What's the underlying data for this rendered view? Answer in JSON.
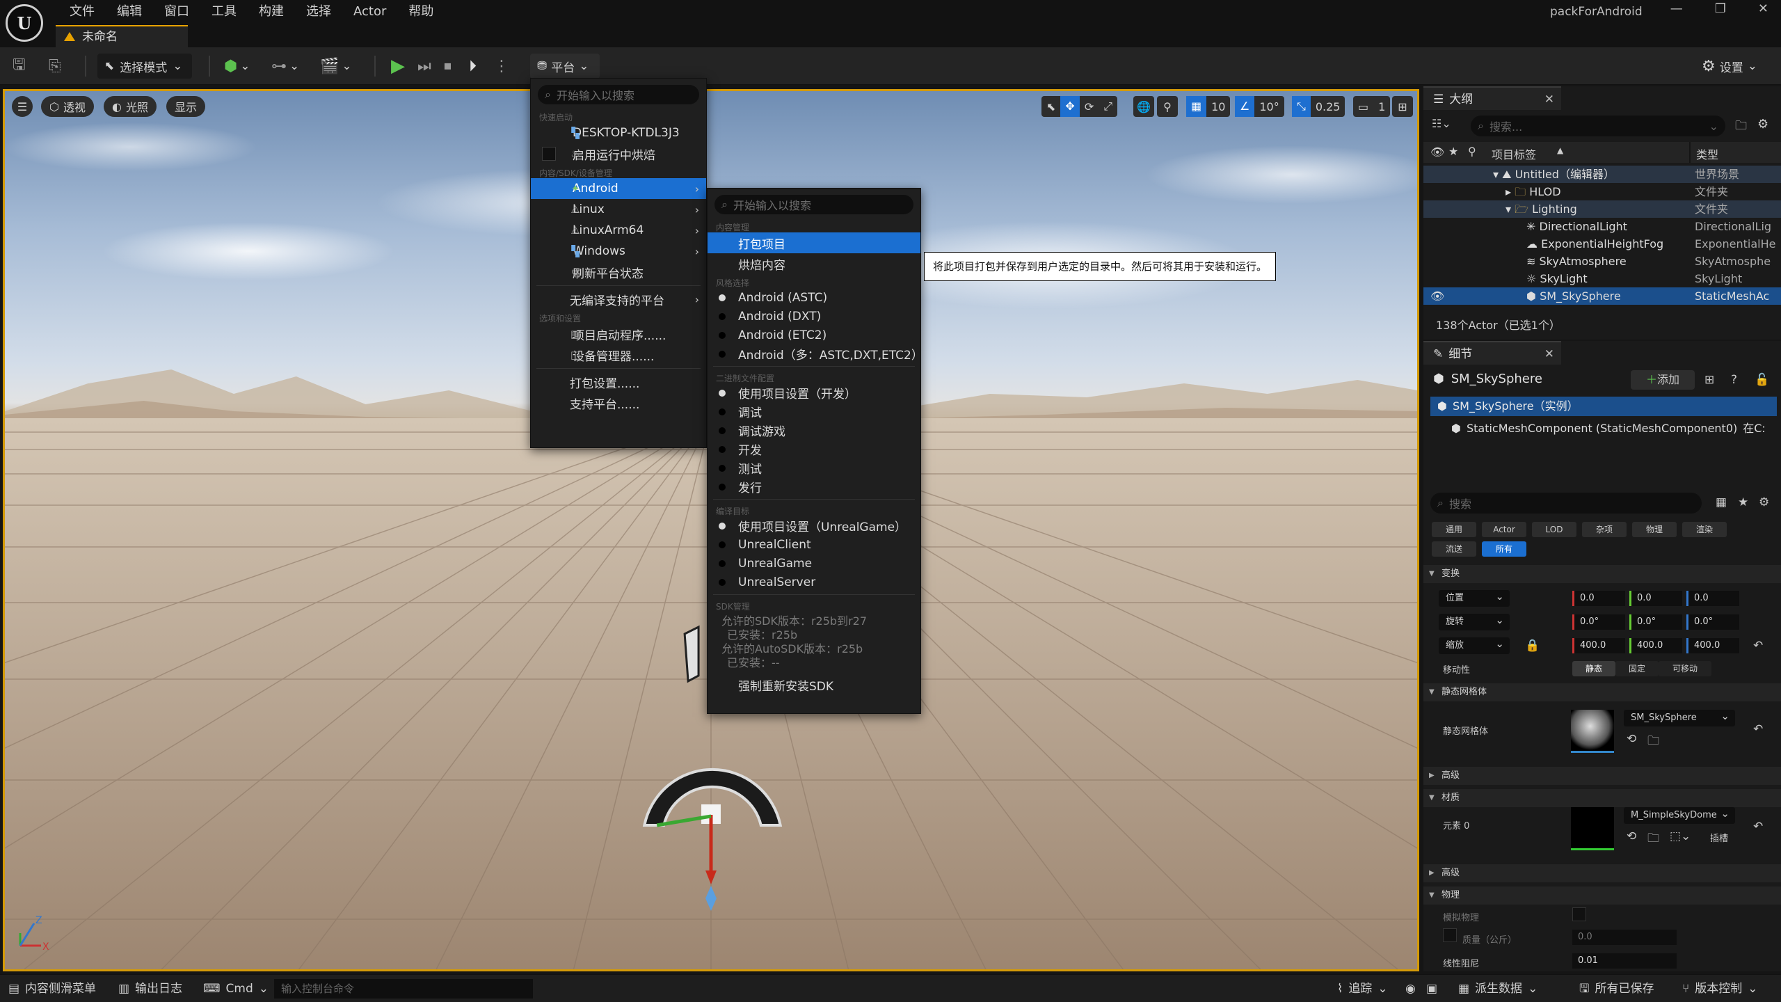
{
  "app": {
    "logo": "U",
    "menu": [
      "文件",
      "编辑",
      "窗口",
      "工具",
      "构建",
      "选择",
      "Actor",
      "帮助"
    ],
    "project_name": "packForAndroid",
    "doc_tab": "未命名"
  },
  "toolbar": {
    "mode_label": "选择模式",
    "platforms_label": "平台",
    "settings_label": "设置"
  },
  "viewport": {
    "perspective": "透视",
    "lit": "光照",
    "show": "显示",
    "grid_snap": "10",
    "rot_snap": "10°",
    "scale_snap": "0.25",
    "camera_speed": "1"
  },
  "platforms_menu": {
    "search_placeholder": "开始输入以搜索",
    "hdr_quick": "快速启动",
    "quick_device": "DESKTOP-KTDL3J3",
    "cook_on_fly": "启用运行中烘焙",
    "hdr_content": "内容/SDK/设备管理",
    "platforms": [
      "Android",
      "Linux",
      "LinuxArm64",
      "Windows"
    ],
    "refresh": "刷新平台状态",
    "unsupported": "无编译支持的平台",
    "hdr_options": "选项和设置",
    "launcher": "项目启动程序......",
    "device_mgr": "设备管理器......",
    "pack_settings": "打包设置......",
    "supported": "支持平台......"
  },
  "android_menu": {
    "search_placeholder": "开始输入以搜索",
    "hdr_content": "内容管理",
    "package": "打包项目",
    "cook": "烘焙内容",
    "hdr_flavor": "风格选择",
    "flavors": [
      "Android (ASTC)",
      "Android (DXT)",
      "Android (ETC2)",
      "Android（多：ASTC,DXT,ETC2）"
    ],
    "hdr_binary": "二进制文件配置",
    "configs": [
      "使用项目设置（开发）",
      "调试",
      "调试游戏",
      "开发",
      "测试",
      "发行"
    ],
    "hdr_target": "编译目标",
    "targets": [
      "使用项目设置（UnrealGame）",
      "UnrealClient",
      "UnrealGame",
      "UnrealServer"
    ],
    "hdr_sdk": "SDK管理",
    "sdk_lines": [
      "允许的SDK版本：r25b到r27",
      "已安装：r25b",
      "允许的AutoSDK版本：r25b",
      "已安装：--"
    ],
    "reinstall": "强制重新安装SDK",
    "tooltip": "将此项目打包并保存到用户选定的目录中。然后可将其用于安装和运行。"
  },
  "outliner": {
    "tab": "大纲",
    "search_placeholder": "搜索...",
    "col_label": "项目标签",
    "col_type": "类型",
    "rows": [
      {
        "name": "Untitled（编辑器）",
        "type": "世界场景"
      },
      {
        "name": "HLOD",
        "type": "文件夹"
      },
      {
        "name": "Lighting",
        "type": "文件夹"
      },
      {
        "name": "DirectionalLight",
        "type": "DirectionalLig"
      },
      {
        "name": "ExponentialHeightFog",
        "type": "ExponentialHe"
      },
      {
        "name": "SkyAtmosphere",
        "type": "SkyAtmosphe"
      },
      {
        "name": "SkyLight",
        "type": "SkyLight"
      },
      {
        "name": "SM_SkySphere",
        "type": "StaticMeshAc"
      }
    ],
    "count": "138个Actor（已选1个）"
  },
  "details": {
    "tab": "细节",
    "object": "SM_SkySphere",
    "add_label": "添加",
    "instance": "SM_SkySphere（实例）",
    "component": "StaticMeshComponent (StaticMeshComponent0)",
    "component_suffix": "在C:",
    "search_placeholder": "搜索",
    "filters_row1": [
      "通用",
      "Actor",
      "LOD",
      "杂项",
      "物理",
      "渲染"
    ],
    "filters_row2": [
      "流送",
      "所有"
    ],
    "sec_transform": "变换",
    "location": "位置",
    "rotation": "旋转",
    "scale": "缩放",
    "loc": [
      "0.0",
      "0.0",
      "0.0"
    ],
    "rot": [
      "0.0°",
      "0.0°",
      "0.0°"
    ],
    "scl": [
      "400.0",
      "400.0",
      "400.0"
    ],
    "mobility": "移动性",
    "mob_opts": [
      "静态",
      "固定",
      "可移动"
    ],
    "sec_mesh": "静态网格体",
    "mesh_label": "静态网格体",
    "mesh_value": "SM_SkySphere",
    "sec_adv": "高级",
    "sec_material": "材质",
    "element0": "元素 0",
    "material_value": "M_SimpleSkyDome",
    "slot": "插槽",
    "sec_adv2": "高级",
    "sec_physics": "物理",
    "sim_physics": "模拟物理",
    "mass": "质量（公斤）",
    "mass_value": "0.0",
    "lin_damping": "线性阻尼",
    "lin_damping_value": "0.01"
  },
  "statusbar": {
    "content_drawer": "内容侧滑菜单",
    "output_log": "输出日志",
    "cmd": "Cmd",
    "console_placeholder": "输入控制台命令",
    "trace": "追踪",
    "derived": "派生数据",
    "saved": "所有已保存",
    "vc": "版本控制"
  }
}
